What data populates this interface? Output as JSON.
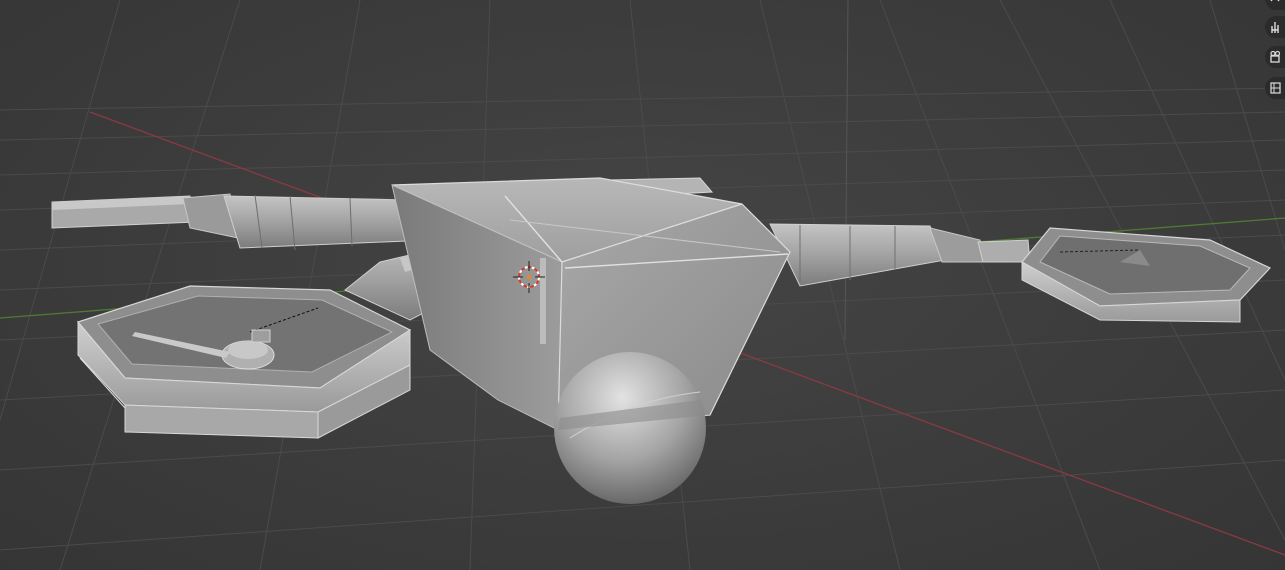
{
  "app": {
    "name": ""
  },
  "viewport": {
    "background": "#3d3d3d",
    "grid_line_color": "#4a4a4a",
    "x_axis_color": "#9b3a40",
    "y_axis_color": "#5a8a3a",
    "mesh_light": "#b6b6b6",
    "mesh_mid": "#8f8f8f",
    "mesh_dark": "#6a6a6a",
    "edge_color": "#d8d8d8"
  },
  "objects": [
    {
      "id": "hull",
      "label": ""
    },
    {
      "id": "sensor-sphere",
      "label": ""
    },
    {
      "id": "arm-front-left",
      "label": ""
    },
    {
      "id": "arm-rear-left",
      "label": ""
    },
    {
      "id": "arm-right",
      "label": ""
    },
    {
      "id": "rotor-guard-left",
      "label": ""
    },
    {
      "id": "rotor-guard-right",
      "label": ""
    }
  ],
  "navigation_gizmo": {
    "buttons": [
      {
        "name": "zoom-icon"
      },
      {
        "name": "pan-hand-icon"
      },
      {
        "name": "camera-view-icon"
      },
      {
        "name": "ortho-grid-icon"
      }
    ]
  },
  "cursor_3d": {
    "color_outer": "#d23a2a",
    "color_inner": "#ffffff"
  }
}
